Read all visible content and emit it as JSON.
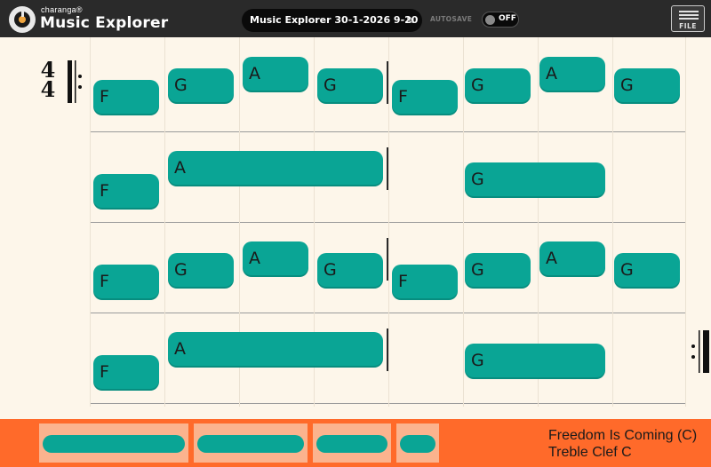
{
  "header": {
    "brand": "charanga®",
    "title": "Music Explorer",
    "document_title": "Music Explorer 30-1-2026 9-20",
    "edit_icon": "pencil-icon",
    "autosave_label": "AUTOSAVE",
    "autosave_state": "OFF",
    "file_label": "FILE"
  },
  "score": {
    "time_signature": {
      "top": "4",
      "bottom": "4"
    },
    "systems": [
      {
        "chords": [
          "F",
          "G",
          "A",
          "G",
          "F",
          "G",
          "A",
          "G"
        ]
      },
      {
        "chords": [
          "F",
          "A",
          "G"
        ]
      },
      {
        "chords": [
          "F",
          "G",
          "A",
          "G",
          "F",
          "G",
          "A",
          "G"
        ]
      },
      {
        "chords": [
          "F",
          "A",
          "G"
        ]
      }
    ]
  },
  "footer": {
    "section_count": 4,
    "song_title": "Freedom Is Coming (C)",
    "clef": "Treble Clef C"
  },
  "colors": {
    "header_bg": "#2a2a2a",
    "paper": "#fdf6ea",
    "chord": "#0aa595",
    "footer": "#ff6a2a",
    "section_bg": "#fbb38e"
  }
}
